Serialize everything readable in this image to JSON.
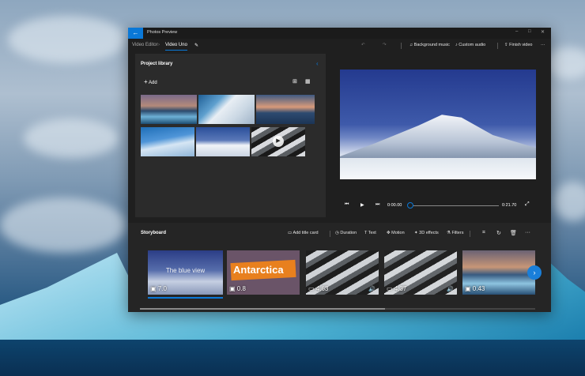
{
  "app": {
    "title": "Photos Preview"
  },
  "nav": {
    "breadcrumb_root": "Video Editor",
    "breadcrumb_current": "Video Uno"
  },
  "toolbar": {
    "background_music": "Background music",
    "custom_audio": "Custom audio",
    "finish_video": "Finish video"
  },
  "library": {
    "title": "Project library",
    "add_label": "Add"
  },
  "player": {
    "current_time": "0:00.00",
    "total_time": "0:21.70"
  },
  "storyboard": {
    "title": "Storyboard",
    "tools": {
      "add_title_card": "Add title card",
      "duration": "Duration",
      "text": "Text",
      "motion": "Motion",
      "effects_3d": "3D effects",
      "filters": "Filters"
    },
    "clips": [
      {
        "overlay": "The blue view",
        "duration": "7.0"
      },
      {
        "overlay": "Antarctica",
        "duration": "0.8"
      },
      {
        "overlay": "",
        "duration": "4.63"
      },
      {
        "overlay": "",
        "duration": "4.37"
      },
      {
        "overlay": "",
        "duration": "0.43"
      }
    ]
  },
  "colors": {
    "accent": "#0a78d7",
    "window_bg": "#1f1f1f",
    "panel_bg": "#2b2b2b"
  }
}
